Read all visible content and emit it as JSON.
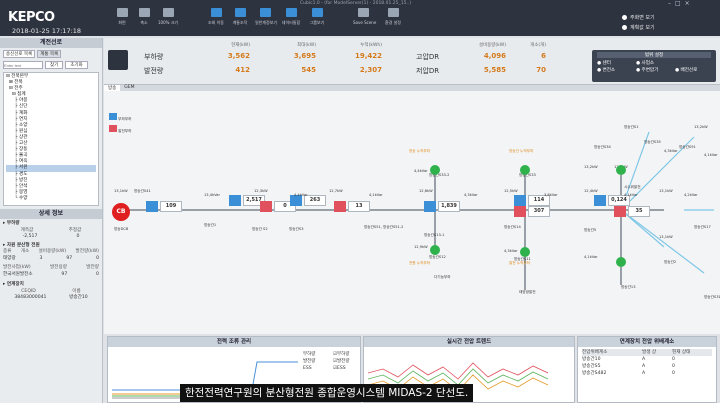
{
  "header": {
    "logo": "KEPCO",
    "datetime": "2018-01-25 17:17:18",
    "window_title": "Cubic1.0 - (for ModelServer(1) - 2018.01.25_15..)",
    "toolbar": [
      {
        "label": "화면",
        "icon": "zoom-icon"
      },
      {
        "label": "축소",
        "icon": "zoom-out-icon"
      },
      {
        "label": "100% 크기",
        "icon": "fit-icon"
      },
      {
        "label": "조회 이동",
        "icon": "move-icon"
      },
      {
        "label": "계통조작",
        "icon": "network-icon"
      },
      {
        "label": "일반계정보기",
        "icon": "account-icon"
      },
      {
        "label": "데이터통합",
        "icon": "data-icon"
      },
      {
        "label": "그룹보기",
        "icon": "group-icon"
      },
      {
        "label": "Save Scene",
        "icon": "save-icon"
      },
      {
        "label": "환경 설정",
        "icon": "settings-icon"
      }
    ],
    "radio_options": [
      "주화면 보기",
      "계획값 보기"
    ]
  },
  "left_panel": {
    "title": "계전선로",
    "tabs": [
      "송신선로 목록",
      "계통 목록"
    ],
    "filter": {
      "placeholder": "Enter text",
      "search_btn": "찾기",
      "reset_btn": "초기화"
    },
    "tree": [
      "⊟ 전북본부",
      "  ⊞ 전북",
      "  ⊟ 전주",
      "    ⊟ 접계",
      "      ├ 야봉",
      "      ├ 신단",
      "      ├ 계화",
      "      ├ 연지",
      "      ├ 소양",
      "      ├ 원심",
      "      ├ 상관",
      "      ├ 고산",
      "      ├ 장동",
      "      ├ 율곡",
      "      ├ 여옥",
      "      ├ 서원",
      "      ├ 경도",
      "      ├ 방진",
      "      ├ 안석",
      "      ├ 봉영",
      "      └ 수양"
    ],
    "selected_index": 15,
    "detail_title": "상세 정보",
    "section1": "▸ 부하량",
    "load_headers": [
      "계측값",
      "추정값"
    ],
    "load_values": [
      "-2,517",
      "0"
    ],
    "section2": "▸ 자원 분산형 전원",
    "dg_headers": [
      "종류",
      "개소",
      "설비용량(kW)",
      "발전량(kW)"
    ],
    "dg_row": [
      "태양광",
      "3",
      "97",
      "0"
    ],
    "dg_headers2": [
      "발전사업(kW)",
      "발전용량",
      "발전량"
    ],
    "dg_row2": [
      "한국서원발전소",
      "97",
      "0"
    ],
    "section3": "▸ 연계장치",
    "dev_headers": [
      "CEQID",
      "이름"
    ],
    "dev_row": [
      "38483000041",
      "방송간10"
    ]
  },
  "summary": {
    "col_headers": [
      "현재(kW)",
      "최대(kW)",
      "누적(kWh)"
    ],
    "rows": [
      {
        "label": "부하량",
        "values": [
          "3,562",
          "3,695",
          "19,422"
        ]
      },
      {
        "label": "발전량",
        "values": [
          "412",
          "545",
          "2,307"
        ]
      }
    ],
    "col_headers2": [
      "설비용량(kW)",
      "개소(개)"
    ],
    "rows2": [
      {
        "label": "고압DR",
        "values": [
          "4,096",
          "6"
        ]
      },
      {
        "label": "저압DR",
        "values": [
          "5,585",
          "70"
        ]
      }
    ],
    "legend_title": "범위 설정",
    "legend": [
      "센터",
      "사업소",
      "변전소",
      "주변압기",
      "배전선로"
    ]
  },
  "diagram": {
    "tabs": [
      "방송",
      "GEM"
    ],
    "cb_label": "CB",
    "legend_boxes": [
      "부하부하",
      "발전부하",
      "부하전력",
      "발전전력"
    ],
    "nodes": [
      {
        "v": "109"
      },
      {
        "v": "2,517"
      },
      {
        "v": "0"
      },
      {
        "v": "263"
      },
      {
        "v": "13"
      },
      {
        "v": "1,839"
      },
      {
        "v": "114"
      },
      {
        "v": "307"
      },
      {
        "v": "0,124"
      },
      {
        "v": "35"
      }
    ],
    "labels": [
      "방송DCB",
      "방송간1",
      "방송간 S2",
      "방송간S3",
      "방송간S51, 방송간S51-2",
      "방송간S13-1",
      "방송간S14",
      "방송간5",
      "방송간S11",
      "방송간S12",
      "방송간13",
      "방송간S33-2",
      "방송간S33",
      "방송간S34",
      "방송간S35",
      "방송간S91",
      "방송간S17",
      "방송간2",
      "방송간S31",
      "방송간S1",
      "태양광발전",
      "다기능부하",
      "시수위발전",
      "방송간S41"
    ],
    "small_vals": [
      "13,1kW",
      "13,4kVar",
      "12,3kW",
      "4,4kVar",
      "12,7kW",
      "4,1kVar",
      "12,6kW",
      "4,3kVar",
      "12,5kW",
      "3,8kVar",
      "12,4kW",
      "4,1kVar",
      "13,1kW",
      "4,2kVar",
      "13,2kW",
      "4,1kVar",
      "13,1kW",
      "4,3kVar",
      "13,2kW",
      "4,1kVar",
      "12,7kW",
      "4,4kVar",
      "12,9kW",
      "4,3kVar"
    ],
    "orange_labels": [
      "방송 누적부하",
      "방송간 누적부하",
      "전원 누적부하",
      "발전 누적부하"
    ]
  },
  "panels": {
    "power_flow_title": "전력 조류 관리",
    "power_flow_legend": [
      "부하량",
      "발전량",
      "ESS"
    ],
    "power_flow_checks": [
      "부하량",
      "발전량",
      "ESS"
    ],
    "trend_title": "실시간 전압 트렌드",
    "device_title": "연계장치 전압 위배계소",
    "device_headers": [
      "전압위배계소",
      "발생 상",
      "현재 상태"
    ],
    "device_rows": [
      [
        "방송간10",
        "A",
        "0"
      ],
      [
        "방송간S5",
        "A",
        "0"
      ],
      [
        "방송간S482",
        "A",
        "0"
      ]
    ]
  },
  "subtitle": "한전전력연구원의 분산형전원 종합운영시스템 MIDAS-2 단선도."
}
